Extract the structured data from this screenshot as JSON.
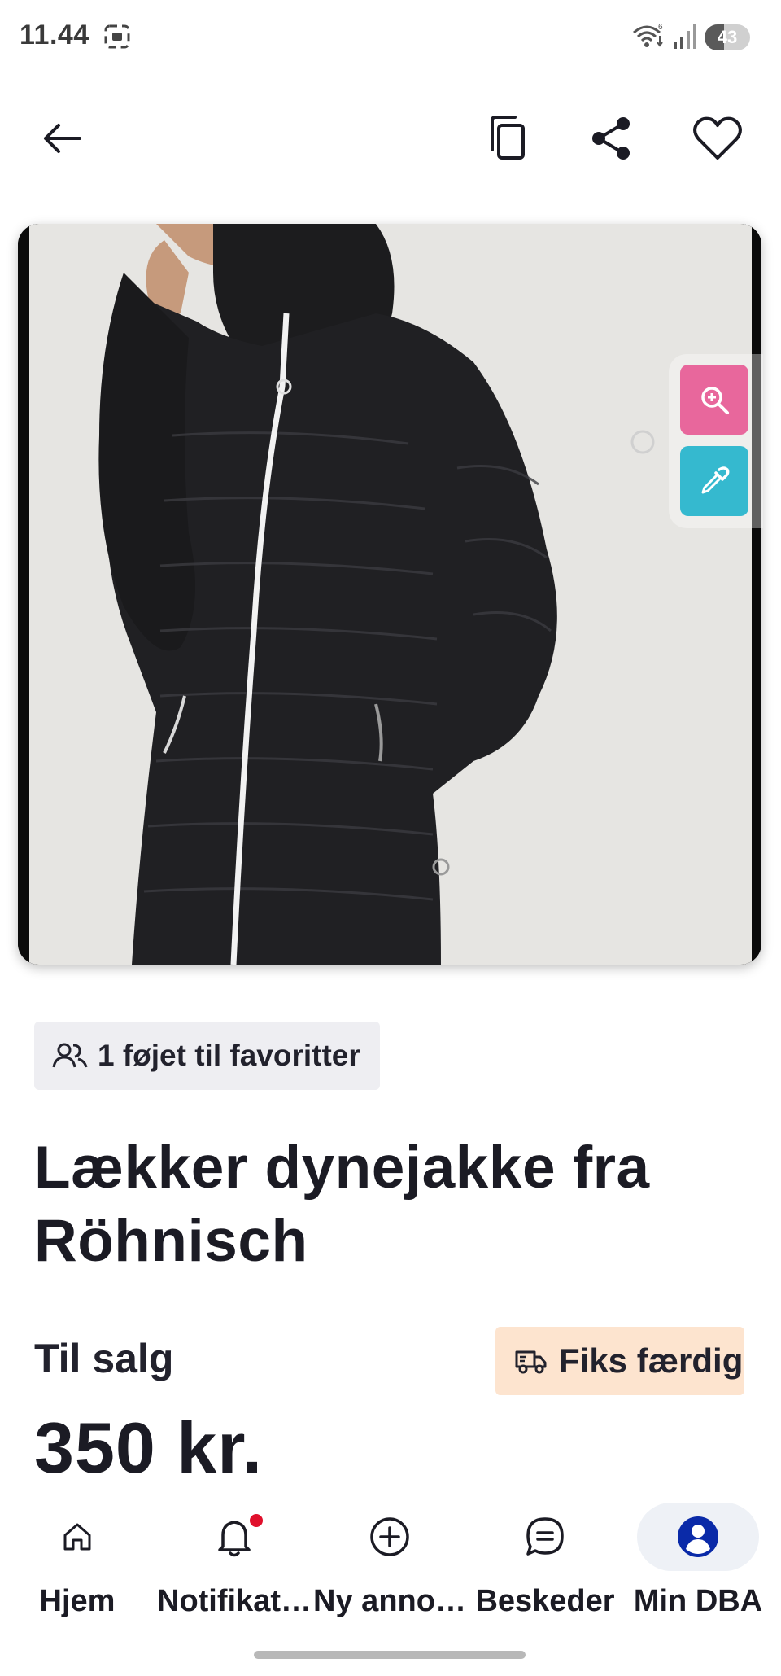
{
  "status_bar": {
    "time": "11.44",
    "battery": "43",
    "battery_level": 0.43
  },
  "top_bar": {
    "back_icon": "arrow-left-icon",
    "copy_icon": "copy-icon",
    "share_icon": "share-icon",
    "favorite_icon": "heart-outline-icon"
  },
  "image_tools": {
    "zoom_icon": "zoom-in-icon",
    "picker_icon": "eyedropper-icon"
  },
  "listing": {
    "favorites_text": "1 føjet til favoritter",
    "title": "Lækker dynejakke fra Röhnisch",
    "sale_type": "Til salg",
    "fiks_label": "Fiks færdig",
    "price": "350 kr."
  },
  "bottom_nav": {
    "items": [
      {
        "label": "Hjem",
        "icon": "home-icon"
      },
      {
        "label": "Notifikat…",
        "icon": "bell-icon"
      },
      {
        "label": "Ny anno…",
        "icon": "plus-circle-icon"
      },
      {
        "label": "Beskeder",
        "icon": "chat-icon"
      },
      {
        "label": "Min DBA",
        "icon": "user-avatar-icon"
      }
    ]
  },
  "colors": {
    "accent_blue": "#0a2aa8",
    "fiks_badge_bg": "#fde4cf",
    "zoom_tool": "#e8679c",
    "picker_tool": "#35b9cf",
    "notification_dot": "#e0102c"
  }
}
